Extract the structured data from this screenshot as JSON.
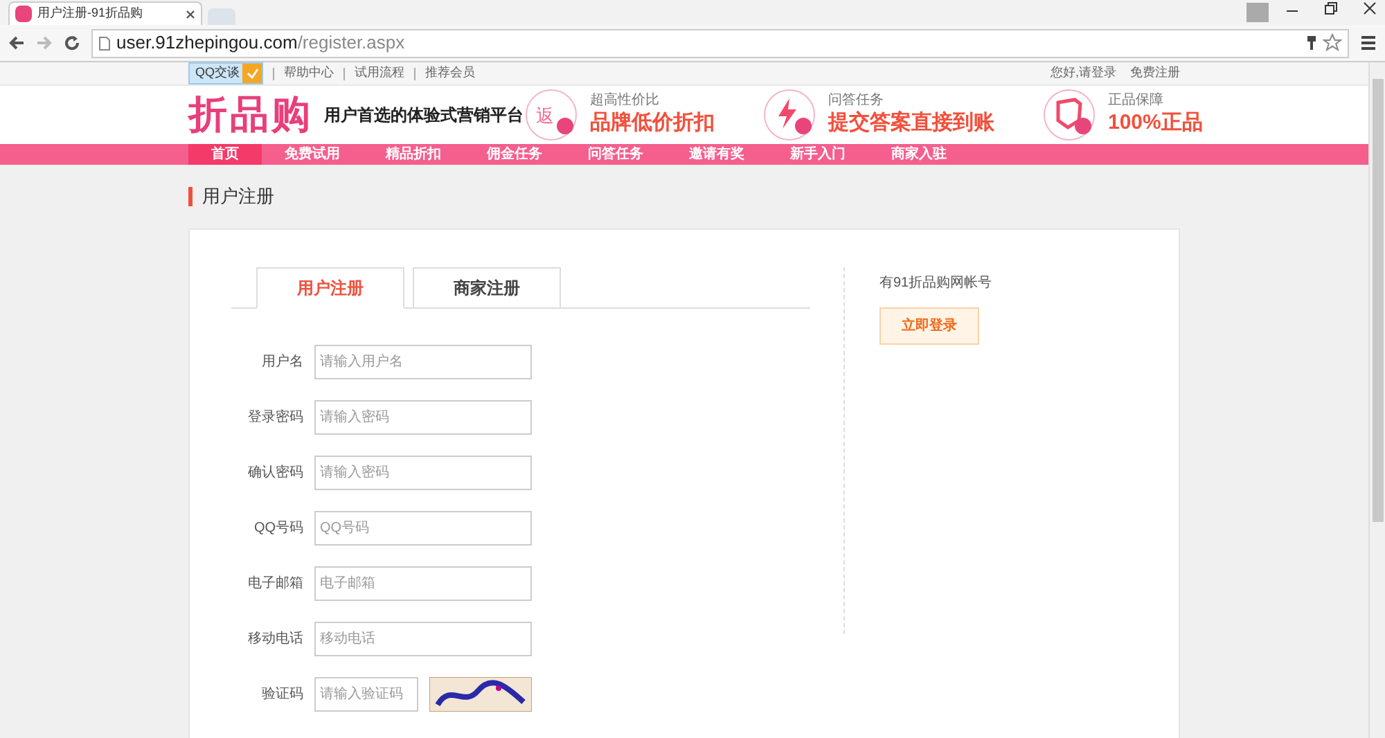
{
  "browser": {
    "tab_title": "用户注册-91折品购",
    "url_host": "user.91zhepingou.com",
    "url_path": "/register.aspx"
  },
  "topbar": {
    "qq": "QQ交谈",
    "links": [
      "帮助中心",
      "试用流程",
      "推荐会员"
    ],
    "right": [
      "您好,请登录",
      "免费注册"
    ]
  },
  "header": {
    "logo": "折品购",
    "slogan": "用户首选的体验式营销平台",
    "features": [
      {
        "kind": "return",
        "icon_text": "返",
        "small": "超高性价比",
        "big": "品牌低价折扣"
      },
      {
        "kind": "bolt",
        "small": "问答任务",
        "big": "提交答案直接到账"
      },
      {
        "kind": "shield",
        "small": "正品保障",
        "big": "100%正品"
      }
    ]
  },
  "nav": [
    {
      "label": "首页",
      "selected": true
    },
    {
      "label": "免费试用",
      "selected": false
    },
    {
      "label": "精品折扣",
      "selected": false
    },
    {
      "label": "佣金任务",
      "selected": false
    },
    {
      "label": "问答任务",
      "selected": false
    },
    {
      "label": "邀请有奖",
      "selected": false
    },
    {
      "label": "新手入门",
      "selected": false
    },
    {
      "label": "商家入驻",
      "selected": false
    }
  ],
  "section_title": "用户注册",
  "tabs": [
    {
      "label": "用户注册",
      "selected": true
    },
    {
      "label": "商家注册",
      "selected": false
    }
  ],
  "fields": [
    {
      "label": "用户名",
      "placeholder": "请输入用户名"
    },
    {
      "label": "登录密码",
      "placeholder": "请输入密码"
    },
    {
      "label": "确认密码",
      "placeholder": "请输入密码"
    },
    {
      "label": "QQ号码",
      "placeholder": "QQ号码"
    },
    {
      "label": "电子邮箱",
      "placeholder": "电子邮箱"
    },
    {
      "label": "移动电话",
      "placeholder": "移动电话"
    },
    {
      "label": "验证码",
      "placeholder": "请输入验证码",
      "kind": "captcha"
    }
  ],
  "side": {
    "text": "有91折品购网帐号",
    "button": "立即登录"
  }
}
